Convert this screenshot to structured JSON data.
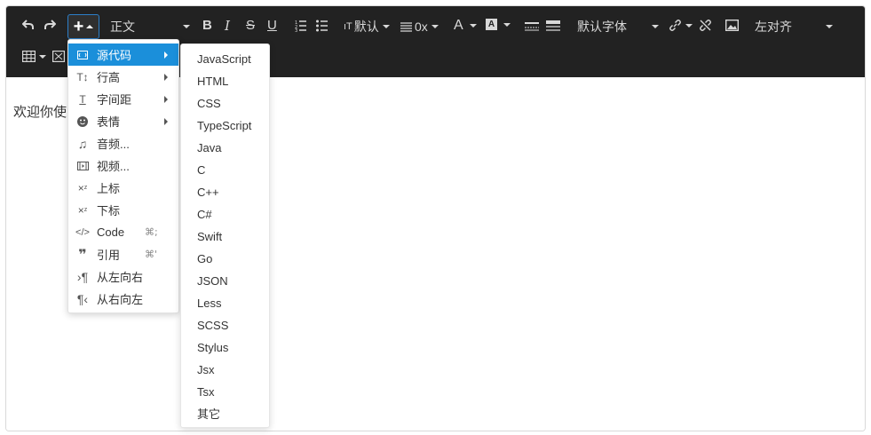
{
  "toolbar": {
    "paragraph_style": "正文",
    "line_height_label": "默认",
    "spacing_label": "0x",
    "font_color_letter": "A",
    "font_family_label": "默认字体",
    "align_label": "左对齐"
  },
  "content": {
    "visible_text": "欢迎你使"
  },
  "insert_menu": {
    "items": [
      {
        "label": "源代码",
        "icon": "source-code-icon",
        "submenu": true,
        "active": true
      },
      {
        "label": "行高",
        "icon": "line-height-icon",
        "submenu": true
      },
      {
        "label": "字间距",
        "icon": "letter-spacing-icon",
        "submenu": true
      },
      {
        "label": "表情",
        "icon": "emoji-icon",
        "submenu": true
      },
      {
        "label": "音频...",
        "icon": "audio-icon"
      },
      {
        "label": "视频...",
        "icon": "video-icon"
      },
      {
        "label": "上标",
        "icon": "superscript-icon"
      },
      {
        "label": "下标",
        "icon": "subscript-icon"
      },
      {
        "label": "Code",
        "icon": "code-icon",
        "shortcut": "⌘;"
      },
      {
        "label": "引用",
        "icon": "quote-icon",
        "shortcut": "⌘'"
      },
      {
        "label": "从左向右",
        "icon": "ltr-icon"
      },
      {
        "label": "从右向左",
        "icon": "rtl-icon"
      }
    ]
  },
  "languages": [
    "JavaScript",
    "HTML",
    "CSS",
    "TypeScript",
    "Java",
    "C",
    "C++",
    "C#",
    "Swift",
    "Go",
    "JSON",
    "Less",
    "SCSS",
    "Stylus",
    "Jsx",
    "Tsx",
    "其它"
  ],
  "colors": {
    "toolbar_bg": "#222222",
    "active_item": "#1b8fda",
    "toolbar_icon": "#d8d8d8"
  }
}
